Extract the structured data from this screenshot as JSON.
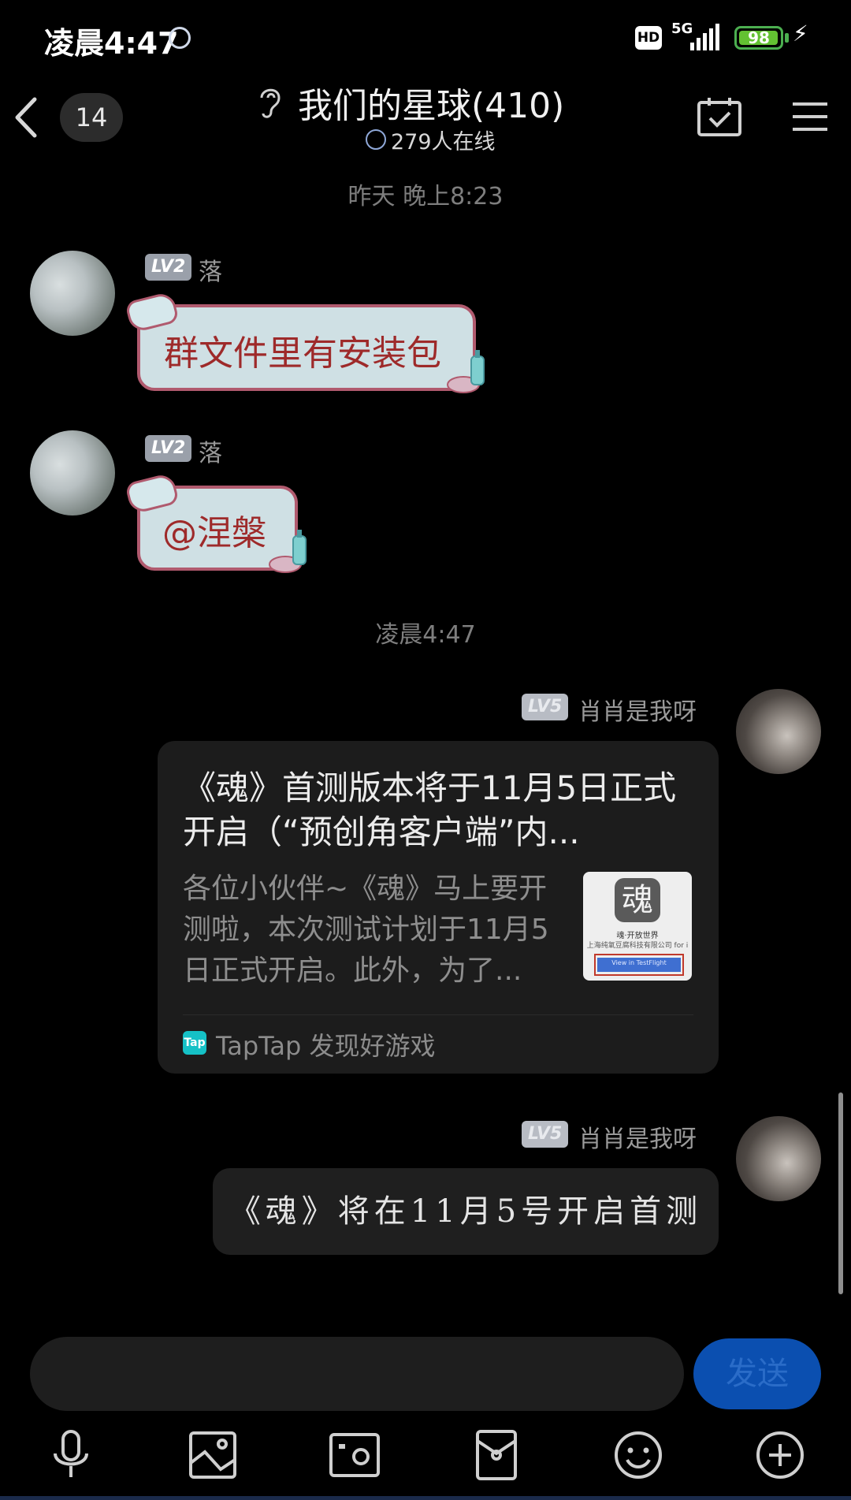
{
  "status_bar": {
    "time": "凌晨4:47",
    "hd": "HD",
    "network": "5G",
    "battery": "98",
    "battery_level": 0.98
  },
  "header": {
    "unread_count": "14",
    "title": "我们的星球(410)",
    "online": "279人在线"
  },
  "messages": [
    {
      "type": "timestamp",
      "text": "昨天 晚上8:23"
    },
    {
      "type": "text",
      "level": "LV2",
      "nickname": "落",
      "text": "群文件里有安装包"
    },
    {
      "type": "text",
      "level": "LV2",
      "nickname": "落",
      "text": "@涅槃"
    },
    {
      "type": "timestamp",
      "text": "凌晨4:47"
    },
    {
      "type": "card",
      "level": "LV5",
      "nickname": "肖肖是我呀",
      "title": "《魂》首测版本将于11月5日正式开启（“预创角客户端”内...",
      "description": "各位小伙伴~《魂》马上要开测啦，本次测试计划于11月5日正式开启。此外，为了...",
      "thumb_char": "魂",
      "thumb_line1": "魂·开放世界",
      "thumb_line2": "上海纯氧豆腐科技有限公司 for i",
      "thumb_button": "View in TestFlight",
      "source_logo": "Tap",
      "source": "TapTap 发现好游戏"
    },
    {
      "type": "text",
      "level": "LV5",
      "nickname": "肖肖是我呀",
      "text": "《魂》将在11月5号开启首测"
    }
  ],
  "input": {
    "placeholder": "",
    "send_label": "发送"
  },
  "toolbar": {
    "items": [
      "microphone-icon",
      "picture-icon",
      "camera-icon",
      "red-packet-icon",
      "emoji-icon",
      "plus-icon"
    ]
  },
  "colors": {
    "background": "#000000",
    "bubble_theme": "#cfe0e4",
    "bubble_text": "#9e2a2a",
    "send_button": "#0b4fb0",
    "battery": "#63c132"
  }
}
